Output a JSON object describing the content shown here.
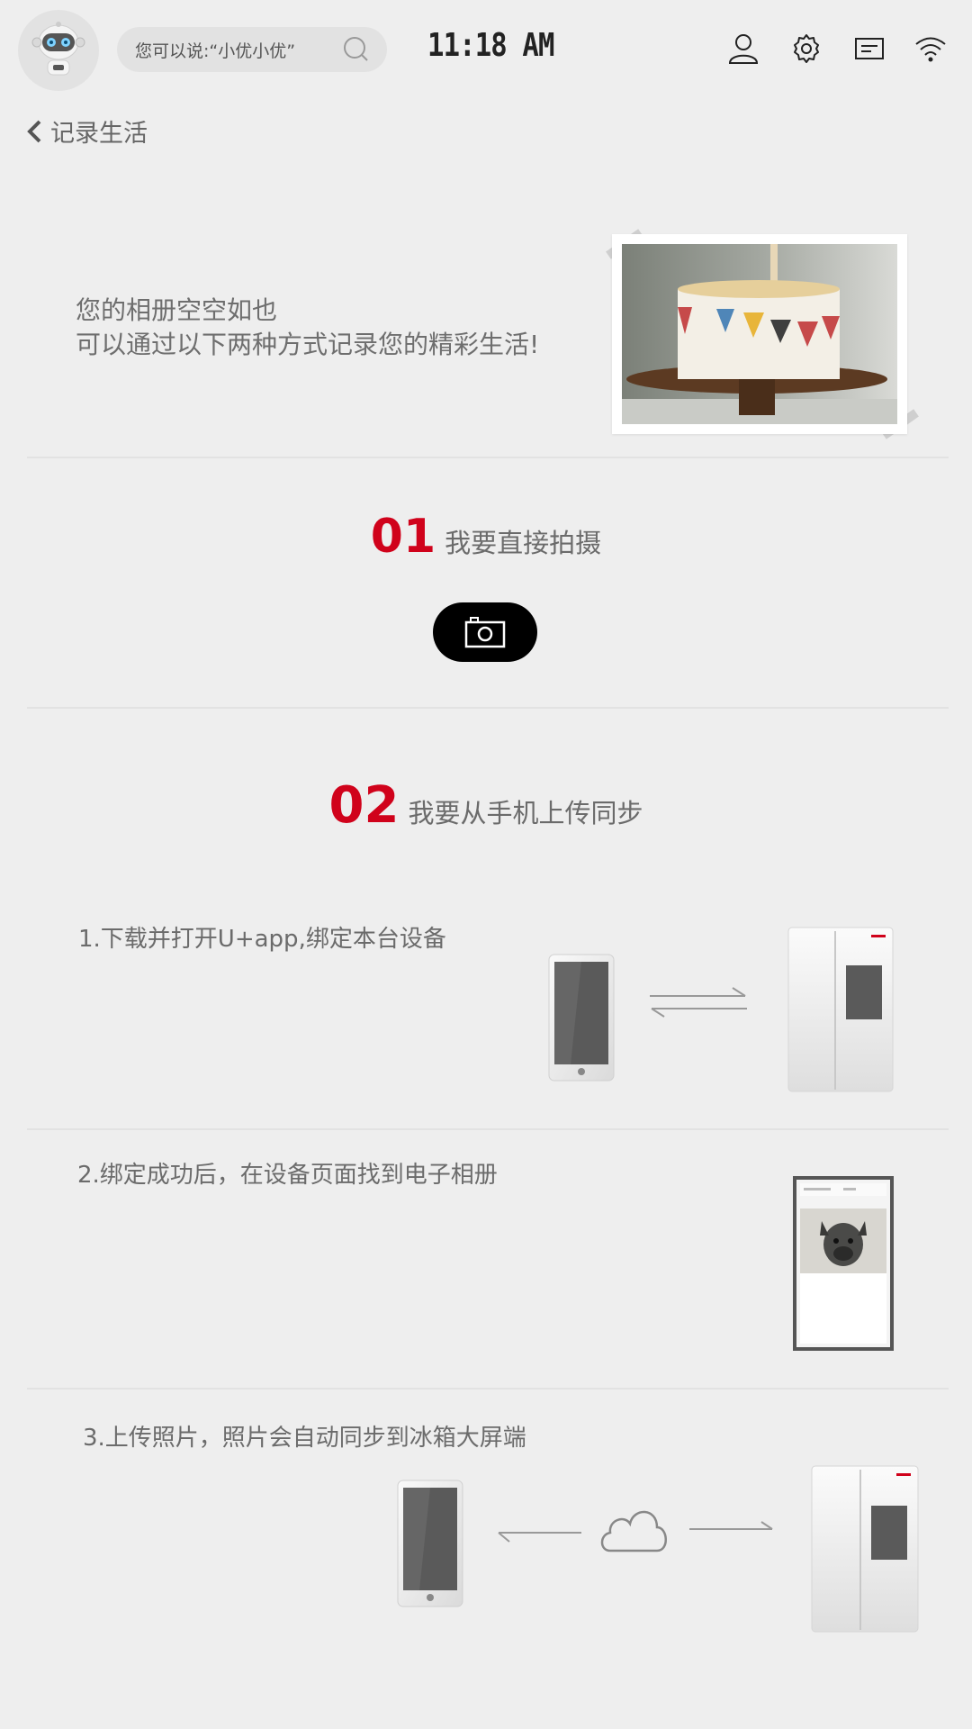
{
  "status_bar": {
    "search_placeholder": "您可以说:“小优小优”",
    "time": "11:18 AM"
  },
  "nav": {
    "back_label": "记录生活"
  },
  "intro": {
    "line1": "您的相册空空如也",
    "line2": "可以通过以下两种方式记录您的精彩生活!"
  },
  "section1": {
    "number": "01",
    "title": "我要直接拍摄"
  },
  "section2": {
    "number": "02",
    "title": "我要从手机上传同步"
  },
  "steps": [
    {
      "text": "1.下载并打开U+app,绑定本台设备"
    },
    {
      "text": "2.绑定成功后，在设备页面找到电子相册"
    },
    {
      "text": "3.上传照片，照片会自动同步到冰箱大屏端"
    }
  ],
  "colors": {
    "accent": "#d0021b",
    "background": "#eeeeee",
    "text": "#6b6b6b"
  }
}
